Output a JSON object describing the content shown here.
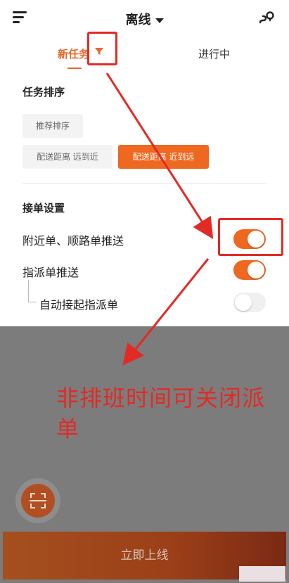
{
  "header": {
    "title": "离线"
  },
  "tabs": [
    {
      "label": "新任务"
    },
    {
      "label": "进行中"
    }
  ],
  "sort": {
    "title": "任务排序",
    "options": [
      {
        "label": "推荐排序",
        "active": false
      },
      {
        "label": "配送距离 远到近",
        "active": false
      },
      {
        "label": "配送距离 近到远",
        "active": true
      }
    ]
  },
  "order_settings": {
    "title": "接单设置",
    "rows": [
      {
        "label": "附近单、顺路单推送",
        "enabled": true
      },
      {
        "label": "指派单推送",
        "enabled": true
      },
      {
        "label": "自动接起指派单",
        "enabled": false
      }
    ]
  },
  "annotation": {
    "text": "非排班时间可关闭派单"
  },
  "footer": {
    "go_online_label": "立即上线"
  },
  "colors": {
    "accent": "#ee6820",
    "annotation_red": "#e22b24",
    "overlay": "#7c7c7c"
  },
  "icons": [
    "menu-icon",
    "location-icon",
    "filter-icon",
    "scan-icon"
  ]
}
